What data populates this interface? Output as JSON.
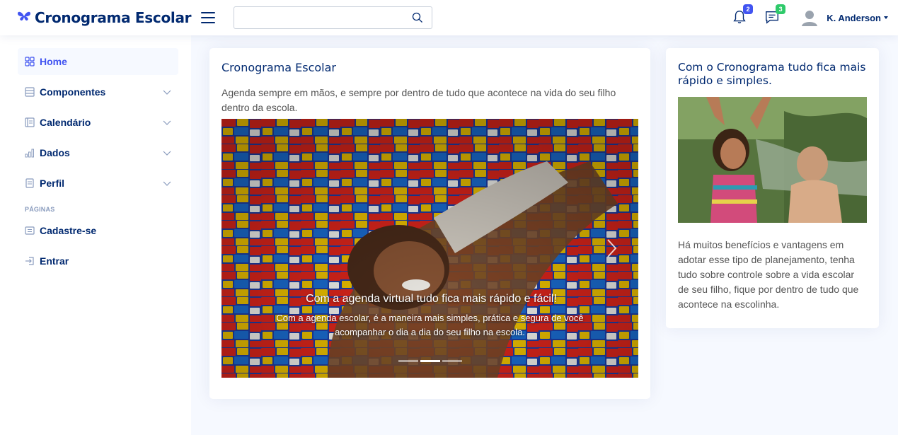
{
  "header": {
    "title": "Cronograma Escolar",
    "search_placeholder": "",
    "notifications_count": "2",
    "messages_count": "3",
    "user_name": "K. Anderson"
  },
  "sidebar": {
    "items": [
      {
        "label": "Home",
        "icon": "grid-icon"
      },
      {
        "label": "Componentes",
        "icon": "menu-icon"
      },
      {
        "label": "Calendário",
        "icon": "journal-icon"
      },
      {
        "label": "Dados",
        "icon": "bar-chart-icon"
      },
      {
        "label": "Perfil",
        "icon": "layout-icon"
      }
    ],
    "heading": "PÁGINAS",
    "pages": [
      {
        "label": "Cadastre-se",
        "icon": "card-list-icon"
      },
      {
        "label": "Entrar",
        "icon": "box-arrow-in-right-icon"
      }
    ]
  },
  "main_card": {
    "title": "Cronograma Escolar",
    "text": "Agenda sempre em mãos, e sempre por dentro de tudo que acontece na vida do seu filho dentro da escola.",
    "carousel": {
      "caption_title": "Com a agenda virtual tudo fica mais rápido e fácil!",
      "caption_text": "Com a agenda escolar, é a maneira mais simples, prática e segura de você acompanhar o dia a dia do seu filho na escola.",
      "active_slide": 2,
      "slides": 3
    }
  },
  "side_card": {
    "title": "Com o Cronograma tudo fica mais rápido e simples.",
    "text": "Há muitos benefícios e vantagens em adotar esse tipo de planejamento, tenha tudo sobre controle sobre a vida escolar de seu filho, fique por dentro de tudo que acontece na escolinha."
  },
  "colors": {
    "brand": "#012970",
    "accent": "#4154f1",
    "badge_green": "#2eca6a",
    "background": "#f6f9ff"
  }
}
